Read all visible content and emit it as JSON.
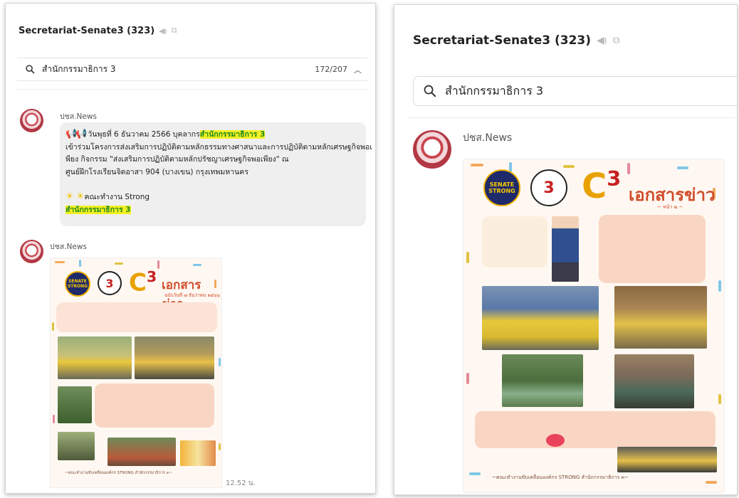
{
  "left": {
    "title": "Secretariat-Senate3 (323)",
    "search_query": "สำนักกรรมาธิการ 3",
    "search_count": "172/207",
    "sender1": "ปชส.News",
    "msg_line1_pre": "วันพุธที่ 6 ธันวาคม 2566 บุคลากร",
    "msg_line1_hl": "สำนักกรรมาธิการ 3",
    "msg_line2": "เข้าร่วมโครงการส่งเสริมการปฏิบัติตามหลักธรรมทางศาสนาและการปฏิบัติตามหลักเศรษฐกิจพอเ",
    "msg_line3": "พียง กิจกรรม  \"ส่งเสริมการปฏิบัติตามหลักปรัชญาเศรษฐกิจพอเพียง\" ณ",
    "msg_line4": "ศูนย์ฝึกโรงเรียนจิตอาสา 904 (บางเขน) กรุงเทพมหานคร",
    "msg_team": "คณะทำงาน Strong",
    "msg_sign": "สำนักกรรมาธิการ 3",
    "sender2": "ปชส.News",
    "time": "12.52 น.",
    "poster": {
      "logo1": "SENATE STRONG",
      "logo2": "3",
      "c3_letter": "C",
      "c3_sup": "3",
      "title": "เอกสารข่าว",
      "subtitle": "ฉบับวันที่ ๗ ธันวาคม ๒๕๖๖",
      "footer": "~คณะทำงานขับเคลื่อนองค์กร STRONG สำนักกรรมาธิการ ๓~"
    }
  },
  "right": {
    "title": "Secretariat-Senate3 (323)",
    "search_query": "สำนักกรรมาธิการ 3",
    "sender": "ปชส.News",
    "poster": {
      "logo1": "SENATE STRONG",
      "logo2": "3",
      "c3_letter": "C",
      "c3_sup": "3",
      "title": "เอกสารข่าว",
      "subtitle": "~ หน้า ๒ ~",
      "footer": "~คณะทำงานขับเคลื่อนองค์กร STRONG สำนักกรรมาธิการ ๓~"
    }
  },
  "colors": {
    "highlight": "#f4f022",
    "highlight_text": "#1e8a1e",
    "poster_accent": "#d14c2a",
    "avatar": "#b23844"
  },
  "icons": {
    "mute": "mute-icon",
    "copy": "copy-icon",
    "search": "search-icon",
    "chevron": "chevron-up-icon",
    "megaphone": "megaphone-icon",
    "sparkle": "sparkle-icon"
  }
}
